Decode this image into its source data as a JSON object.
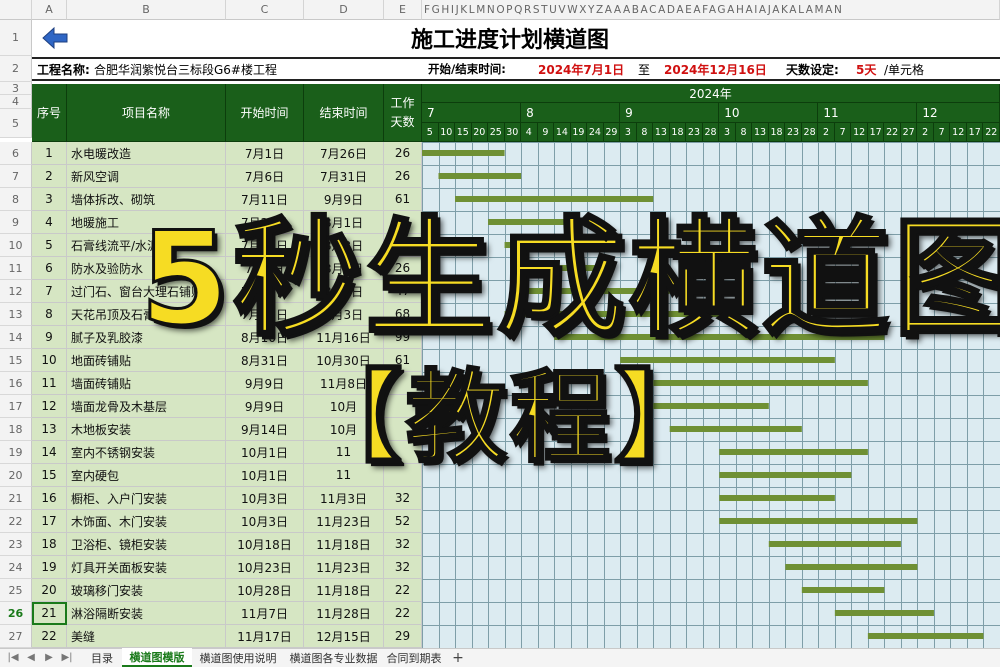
{
  "sheet": {
    "col_letters_main": [
      "A",
      "B",
      "C",
      "D",
      "E"
    ],
    "col_letters_tail": "FGHIJKLMNOPQRSTUVWXYZAAABACADAEAFAGAHAIAJAKALAMAN",
    "row_numbers": [
      "1",
      "2",
      "3",
      "4",
      "5",
      "6",
      "7",
      "8",
      "9",
      "10",
      "11",
      "12",
      "13",
      "14",
      "15",
      "16",
      "17",
      "18",
      "19",
      "20",
      "21",
      "22",
      "23",
      "24",
      "25",
      "26",
      "27"
    ],
    "title": "施工进度计划横道图",
    "project_label": "工程名称:",
    "project_name": "合肥华润紫悦台三标段G6#楼工程",
    "period_label": "开始/结束时间:",
    "start_date": "2024年7月1日",
    "to_label": "至",
    "end_date": "2024年12月16日",
    "days_label": "天数设定:",
    "days_value": "5天",
    "days_unit": "/单元格",
    "headers": {
      "seq": "序号",
      "name": "项目名称",
      "start": "开始时间",
      "end": "结束时间",
      "work_days_1": "工作",
      "work_days_2": "天数",
      "year": "2024年"
    },
    "months": [
      "7",
      "8",
      "9",
      "10",
      "11",
      "12"
    ],
    "day_ticks": [
      "5",
      "10",
      "15",
      "20",
      "25",
      "30",
      "4",
      "9",
      "14",
      "19",
      "24",
      "29",
      "3",
      "8",
      "13",
      "18",
      "23",
      "28",
      "3",
      "8",
      "13",
      "18",
      "23",
      "28",
      "2",
      "7",
      "12",
      "17",
      "22",
      "27",
      "2",
      "7",
      "12",
      "17",
      "22"
    ]
  },
  "tasks": [
    {
      "seq": "1",
      "name": "水电暖改造",
      "start": "7月1日",
      "end": "7月26日",
      "days": "26",
      "s": 0,
      "e": 5
    },
    {
      "seq": "2",
      "name": "新风空调",
      "start": "7月6日",
      "end": "7月31日",
      "days": "26",
      "s": 1,
      "e": 6
    },
    {
      "seq": "3",
      "name": "墙体拆改、砌筑",
      "start": "7月11日",
      "end": "9月9日",
      "days": "61",
      "s": 2,
      "e": 14
    },
    {
      "seq": "4",
      "name": "地暖施工",
      "start": "7月20日",
      "end": "8月1日",
      "days": "26",
      "s": 4,
      "e": 9
    },
    {
      "seq": "5",
      "name": "石膏线流平/水泥砂浆",
      "start": "7月25日",
      "end": "8月3日",
      "days": "38",
      "s": 5,
      "e": 12
    },
    {
      "seq": "6",
      "name": "防水及验防水",
      "start": "7月5日",
      "end": "8月3日",
      "days": "26",
      "s": 6,
      "e": 11
    },
    {
      "seq": "7",
      "name": "过门石、窗台大理石铺贴",
      "start": "7月30日",
      "end": "8月1日",
      "days": "47",
      "s": 6,
      "e": 15
    },
    {
      "seq": "8",
      "name": "天花吊顶及石膏板",
      "start": "7月25日",
      "end": "8月3日",
      "days": "68",
      "s": 5,
      "e": 19
    },
    {
      "seq": "9",
      "name": "腻子及乳胶漆",
      "start": "8月10日",
      "end": "11月16日",
      "days": "99",
      "s": 8,
      "e": 28
    },
    {
      "seq": "10",
      "name": "地面砖铺贴",
      "start": "8月31日",
      "end": "10月30日",
      "days": "61",
      "s": 12,
      "e": 25
    },
    {
      "seq": "11",
      "name": "墙面砖铺贴",
      "start": "9月9日",
      "end": "11月8日",
      "days": "",
      "s": 14,
      "e": 27
    },
    {
      "seq": "12",
      "name": "墙面龙骨及木基层",
      "start": "9月9日",
      "end": "10月",
      "days": "",
      "s": 14,
      "e": 21
    },
    {
      "seq": "13",
      "name": "木地板安装",
      "start": "9月14日",
      "end": "10月",
      "days": "",
      "s": 15,
      "e": 23
    },
    {
      "seq": "14",
      "name": "室内不锈钢安装",
      "start": "10月1日",
      "end": "11",
      "days": "",
      "s": 18,
      "e": 27
    },
    {
      "seq": "15",
      "name": "室内硬包",
      "start": "10月1日",
      "end": "11",
      "days": "",
      "s": 18,
      "e": 26
    },
    {
      "seq": "16",
      "name": "橱柜、入户门安装",
      "start": "10月3日",
      "end": "11月3日",
      "days": "32",
      "s": 18,
      "e": 25
    },
    {
      "seq": "17",
      "name": "木饰面、木门安装",
      "start": "10月3日",
      "end": "11月23日",
      "days": "52",
      "s": 18,
      "e": 30
    },
    {
      "seq": "18",
      "name": "卫浴柜、镜柜安装",
      "start": "10月18日",
      "end": "11月18日",
      "days": "32",
      "s": 21,
      "e": 29
    },
    {
      "seq": "19",
      "name": "灯具开关面板安装",
      "start": "10月23日",
      "end": "11月23日",
      "days": "32",
      "s": 22,
      "e": 30
    },
    {
      "seq": "20",
      "name": "玻璃移门安装",
      "start": "10月28日",
      "end": "11月18日",
      "days": "22",
      "s": 23,
      "e": 28
    },
    {
      "seq": "21",
      "name": "淋浴隔断安装",
      "start": "11月7日",
      "end": "11月28日",
      "days": "22",
      "s": 25,
      "e": 31
    },
    {
      "seq": "22",
      "name": "美缝",
      "start": "11月17日",
      "end": "12月15日",
      "days": "29",
      "s": 27,
      "e": 34
    }
  ],
  "sheet_tabs": [
    {
      "label": "目录",
      "active": false
    },
    {
      "label": "横道图模版",
      "active": true
    },
    {
      "label": "横道图使用说明",
      "active": false
    },
    {
      "label": "横道图各专业数据",
      "active": false
    },
    {
      "label": "合同到期表",
      "active": false
    }
  ],
  "add_sheet": "+",
  "overlay": {
    "line1": "5秒生成横道图",
    "line2": "【教程】"
  },
  "colors": {
    "header_green": "#1a5f1a",
    "left_fill": "#d6e6c3",
    "gantt_fill": "#dcebf1",
    "bar": "#6f9034",
    "red_text": "#d01010",
    "overlay_yellow": "#f6dc23"
  }
}
